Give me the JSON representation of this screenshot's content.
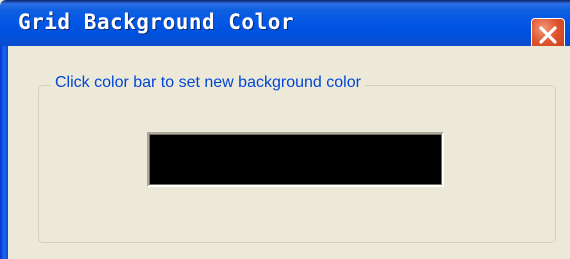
{
  "dialog": {
    "title": "Grid Background Color",
    "close_icon": "close-icon"
  },
  "group": {
    "label": "Click color bar to set new background color"
  },
  "color_bar": {
    "current_color": "#000000"
  },
  "colors": {
    "titlebar": "#0055e5",
    "window_face": "#ece9d8",
    "label_text": "#0046d5",
    "close_button": "#e0552f"
  }
}
